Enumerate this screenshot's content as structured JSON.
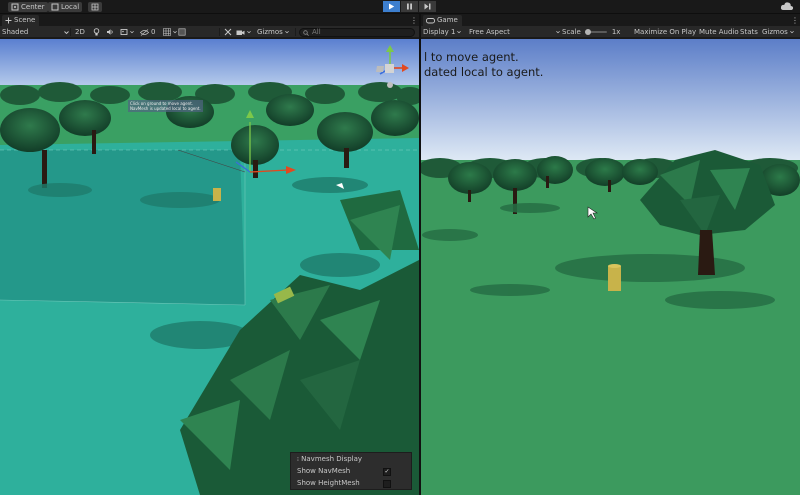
{
  "toolbar": {
    "pivot_label": "Center",
    "space_label": "Local"
  },
  "scene": {
    "tab_label": "Scene",
    "shading_mode": "Shaded",
    "view_2d_label": "2D",
    "gizmos_label": "Gizmos",
    "search_placeholder": "All",
    "layer_count": "0",
    "nav_hint_line1": "Click on ground to move agent.",
    "nav_hint_line2": "NavMesh is updated local to agent."
  },
  "game": {
    "tab_label": "Game",
    "display": "Display 1",
    "aspect": "Free Aspect",
    "scale_label": "Scale",
    "scale_value": "1x",
    "maximize_label": "Maximize On Play",
    "mute_label": "Mute Audio",
    "stats_label": "Stats",
    "gizmos_label": "Gizmos",
    "overlay_line1": "l to move agent.",
    "overlay_line2": "dated local to agent."
  },
  "navmesh_overlay": {
    "title": "Navmesh Display",
    "show_navmesh_label": "Show NavMesh",
    "show_navmesh_checked": true,
    "show_heightmesh_label": "Show HeightMesh",
    "show_heightmesh_checked": false
  },
  "colors": {
    "play_active": "#3d7fcf",
    "editor_bg": "#282828",
    "ground": "#3c9a5e",
    "navmesh": "#2fb19b",
    "sky_top": "#5c7ec8",
    "sky_bottom": "#e2ecf6"
  }
}
